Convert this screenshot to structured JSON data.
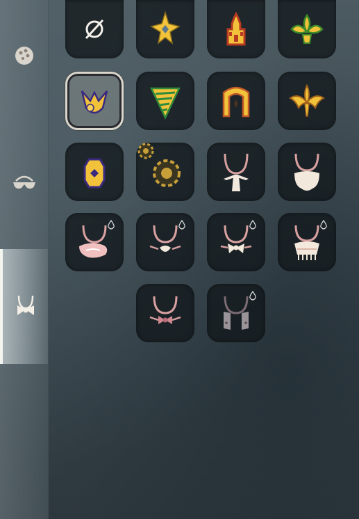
{
  "sidebar": {
    "tabs": [
      {
        "name": "tab-makeup",
        "icon": "palette-icon",
        "active": false
      },
      {
        "name": "tab-glasses",
        "icon": "glasses-icon",
        "active": false
      },
      {
        "name": "tab-neckwear",
        "icon": "neckwear-icon",
        "active": true
      }
    ]
  },
  "grid": {
    "items": [
      {
        "icon": "none-icon",
        "selected": false,
        "dyeable": false
      },
      {
        "icon": "gold-star-emblem-icon",
        "selected": false,
        "dyeable": false
      },
      {
        "icon": "red-castle-emblem-icon",
        "selected": false,
        "dyeable": false
      },
      {
        "icon": "green-fleur-emblem-icon",
        "selected": false,
        "dyeable": false
      },
      {
        "icon": "purple-gold-chevron-emblem-icon",
        "selected": true,
        "dyeable": false
      },
      {
        "icon": "green-spiral-emblem-icon",
        "selected": false,
        "dyeable": false
      },
      {
        "icon": "orange-arch-emblem-icon",
        "selected": false,
        "dyeable": false
      },
      {
        "icon": "gold-trident-emblem-icon",
        "selected": false,
        "dyeable": false
      },
      {
        "icon": "purple-gem-emblem-icon",
        "selected": false,
        "dyeable": false
      },
      {
        "icon": "gear-emblem-icon",
        "selected": false,
        "dyeable": false
      },
      {
        "icon": "cravat-necklace-icon",
        "selected": false,
        "dyeable": false
      },
      {
        "icon": "beard-bib-necklace-icon",
        "selected": false,
        "dyeable": false
      },
      {
        "icon": "scarf-necklace-icon",
        "selected": false,
        "dyeable": true
      },
      {
        "icon": "knot-necklace-icon",
        "selected": false,
        "dyeable": true
      },
      {
        "icon": "bow-necklace-icon",
        "selected": false,
        "dyeable": true
      },
      {
        "icon": "tasseled-scarf-necklace-icon",
        "selected": false,
        "dyeable": true
      },
      {
        "icon": "pink-bow-necklace-icon",
        "selected": false,
        "dyeable": false
      },
      {
        "icon": "stole-necklace-icon",
        "selected": false,
        "dyeable": true
      }
    ]
  },
  "colors": {
    "gold": "#f2c23a",
    "slot_bg": "#12181c",
    "necklace_cord": "#d8a0a0",
    "cream": "#f3e8dc"
  }
}
